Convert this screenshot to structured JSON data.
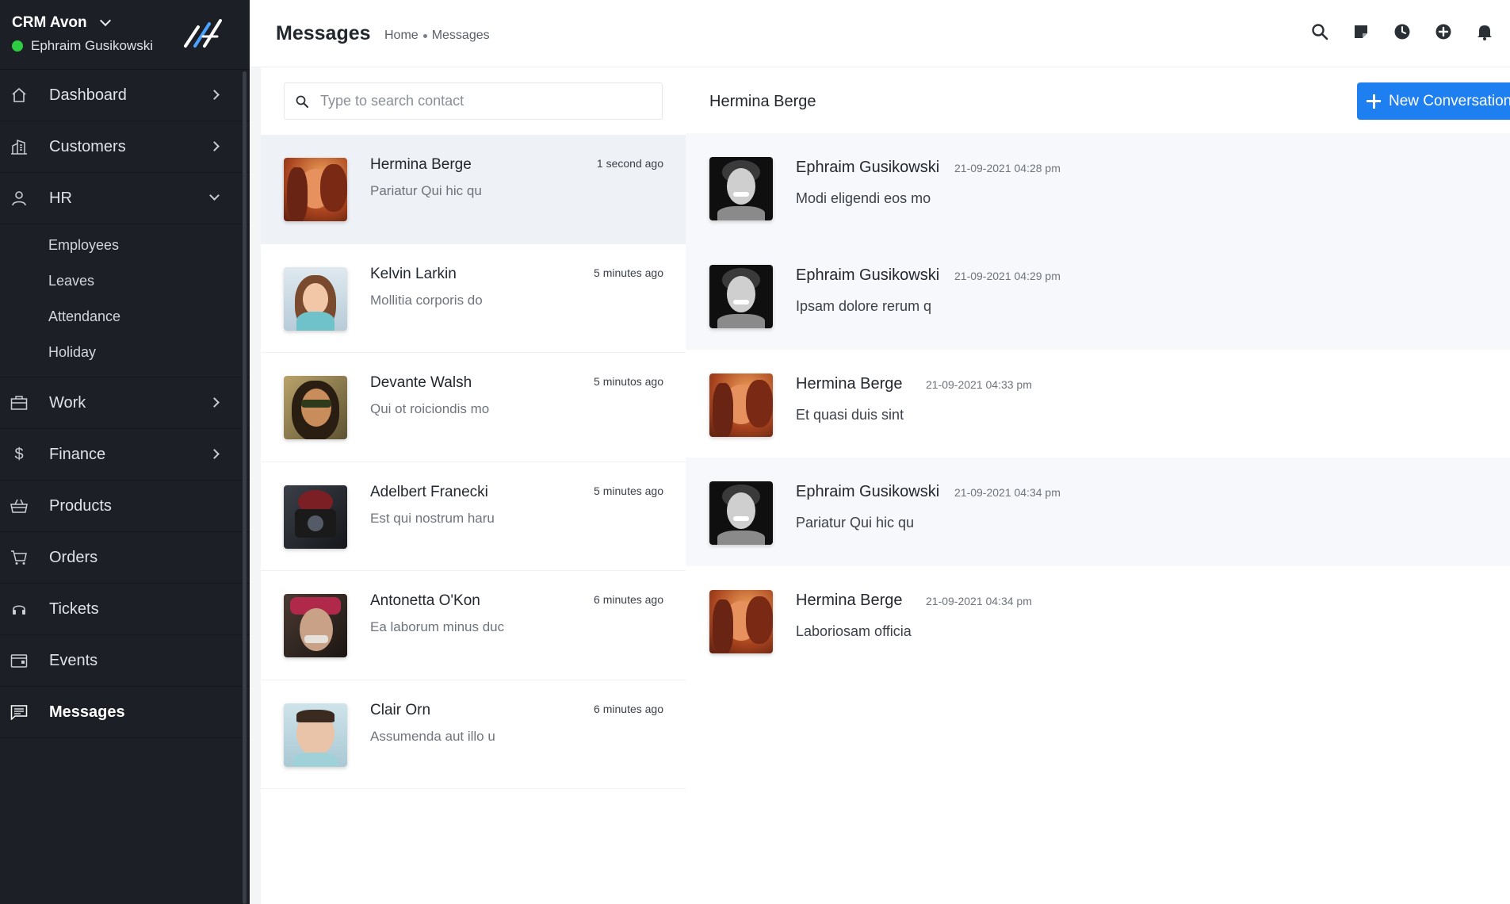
{
  "brand": {
    "name": "CRM Avon",
    "user": "Ephraim Gusikowski"
  },
  "sidebar": {
    "items": [
      {
        "label": "Dashboard",
        "icon": "home-icon",
        "chevron": "right"
      },
      {
        "label": "Customers",
        "icon": "building-icon",
        "chevron": "right"
      },
      {
        "label": "HR",
        "icon": "user-icon",
        "chevron": "down",
        "subitems": [
          "Employees",
          "Leaves",
          "Attendance",
          "Holiday"
        ]
      },
      {
        "label": "Work",
        "icon": "briefcase-icon",
        "chevron": "right"
      },
      {
        "label": "Finance",
        "icon": "dollar-icon",
        "chevron": "right"
      },
      {
        "label": "Products",
        "icon": "basket-icon"
      },
      {
        "label": "Orders",
        "icon": "cart-icon"
      },
      {
        "label": "Tickets",
        "icon": "headset-icon"
      },
      {
        "label": "Events",
        "icon": "calendar-icon"
      },
      {
        "label": "Messages",
        "icon": "message-icon",
        "active": true
      }
    ]
  },
  "header": {
    "title": "Messages",
    "breadcrumb": [
      "Home",
      "Messages"
    ],
    "icons": [
      "search-icon",
      "note-icon",
      "clock-icon",
      "add-circle-icon",
      "bell-icon"
    ]
  },
  "contacts": {
    "search_placeholder": "Type to search contact",
    "list": [
      {
        "name": "Hermina Berge",
        "preview": "Pariatur Qui hic qu",
        "time": "1 second ago",
        "selected": true,
        "avatar": "woman-laughing"
      },
      {
        "name": "Kelvin Larkin",
        "preview": "Mollitia corporis do",
        "time": "5 minutes ago",
        "avatar": "woman-headphones"
      },
      {
        "name": "Devante Walsh",
        "preview": "Qui ot roiciondis mo",
        "time": "5 minutos ago",
        "avatar": "woman-sunglasses"
      },
      {
        "name": "Adelbert Franecki",
        "preview": "Est qui nostrum haru",
        "time": "5 minutes ago",
        "avatar": "man-camera"
      },
      {
        "name": "Antonetta O'Kon",
        "preview": "Ea laborum minus duc",
        "time": "6 minutes ago",
        "avatar": "man-bandana"
      },
      {
        "name": "Clair Orn",
        "preview": "Assumenda aut illo u",
        "time": "6 minutes ago",
        "avatar": "child"
      }
    ]
  },
  "conversation": {
    "title": "Hermina Berge",
    "new_button": "New Conversation",
    "messages": [
      {
        "sender": "Ephraim Gusikowski",
        "time": "21-09-2021 04:28 pm",
        "text": "Modi eligendi eos mo",
        "avatar": "man-smiling",
        "shaded": true
      },
      {
        "sender": "Ephraim Gusikowski",
        "time": "21-09-2021 04:29 pm",
        "text": "Ipsam dolore rerum q",
        "avatar": "man-smiling",
        "shaded": true
      },
      {
        "sender": "Hermina Berge",
        "time": "21-09-2021 04:33 pm",
        "text": "Et quasi duis sint",
        "avatar": "woman-laughing",
        "shaded": false
      },
      {
        "sender": "Ephraim Gusikowski",
        "time": "21-09-2021 04:34 pm",
        "text": "Pariatur Qui hic qu",
        "avatar": "man-smiling",
        "shaded": true
      },
      {
        "sender": "Hermina Berge",
        "time": "21-09-2021 04:34 pm",
        "text": "Laboriosam officia",
        "avatar": "woman-laughing",
        "shaded": false
      }
    ]
  },
  "colors": {
    "sidebar": "#1c2026",
    "accent": "#1e7ff0",
    "online": "#2ecc40",
    "selected_row": "#eef1f6"
  }
}
